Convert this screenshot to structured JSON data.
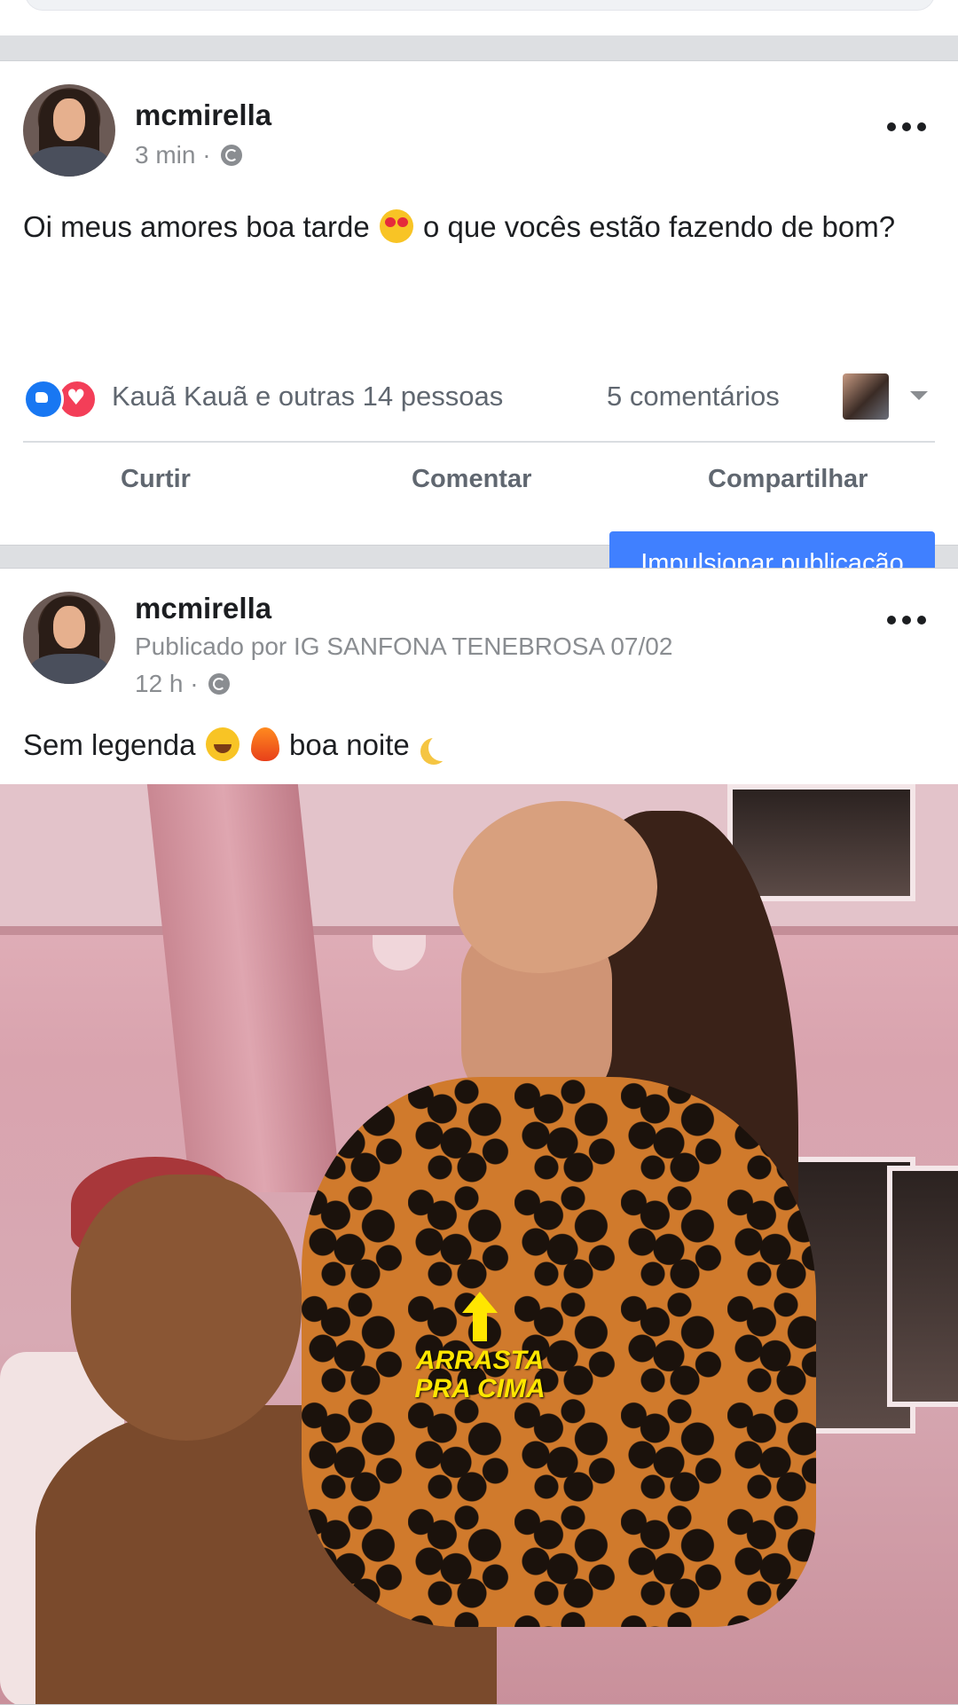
{
  "posts": [
    {
      "author": "mcmirella",
      "time": "3 min",
      "separator": "·",
      "text_part1": "Oi meus amores boa tarde",
      "text_part2": "o que vocês estão fazendo de bom?",
      "emoji": "heart-eyes",
      "reactions": {
        "icons": [
          "like",
          "love"
        ],
        "names": "Kauã Kauã e outras 14 pessoas",
        "comments": "5 comentários"
      },
      "actions": {
        "like": "Curtir",
        "comment": "Comentar",
        "share": "Compartilhar"
      },
      "boost_label": "Impulsionar publicação",
      "colors": {
        "boost": "#4080ff",
        "like": "#1877f2",
        "love": "#f33e58"
      }
    },
    {
      "author": "mcmirella",
      "published_by": "Publicado por IG SANFONA TENEBROSA 07/02",
      "time": "12 h",
      "separator": "·",
      "text_part1": "Sem legenda",
      "text_part2": "boa noite",
      "emojis": [
        "grinning-squinting",
        "fire",
        "crescent-moon"
      ],
      "photo_overlay": {
        "line1": "ARRASTA",
        "line2": "PRA CIMA",
        "color": "#ffe600"
      }
    }
  ]
}
